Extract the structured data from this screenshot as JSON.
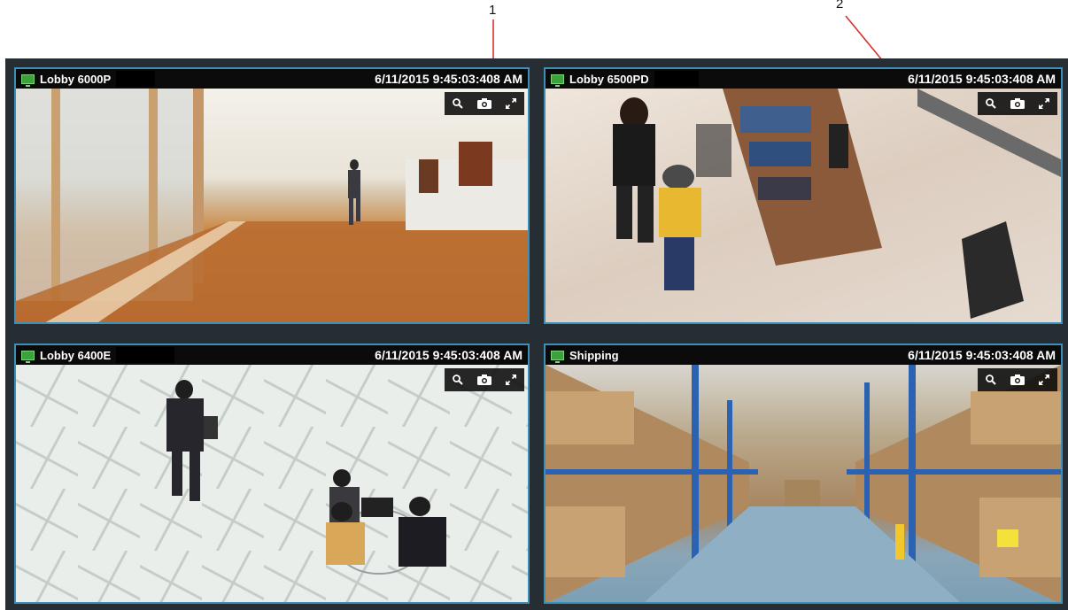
{
  "callouts": [
    {
      "label": "1"
    },
    {
      "label": "2"
    }
  ],
  "tiles": [
    {
      "camera_name": "Lobby 6000P",
      "timestamp": "6/11/2015 9:45:03:408 AM",
      "scene_icon": "hallway"
    },
    {
      "camera_name": "Lobby 6500PD",
      "timestamp": "6/11/2015 9:45:03:408 AM",
      "scene_icon": "store"
    },
    {
      "camera_name": "Lobby 6400E",
      "timestamp": "6/11/2015 9:45:03:408 AM",
      "scene_icon": "lobby-floor"
    },
    {
      "camera_name": "Shipping",
      "timestamp": "6/11/2015 9:45:03:408 AM",
      "scene_icon": "warehouse"
    }
  ],
  "controls": {
    "icons": [
      "search-icon",
      "camera-snapshot-icon",
      "expand-icon"
    ]
  },
  "colors": {
    "viewer_background": "#262d33",
    "tile_border": "#3d8fb8",
    "titlebar": "#0b0b0b",
    "camera_status": "#3aa33a",
    "callout_arrow": "#d9302b"
  }
}
